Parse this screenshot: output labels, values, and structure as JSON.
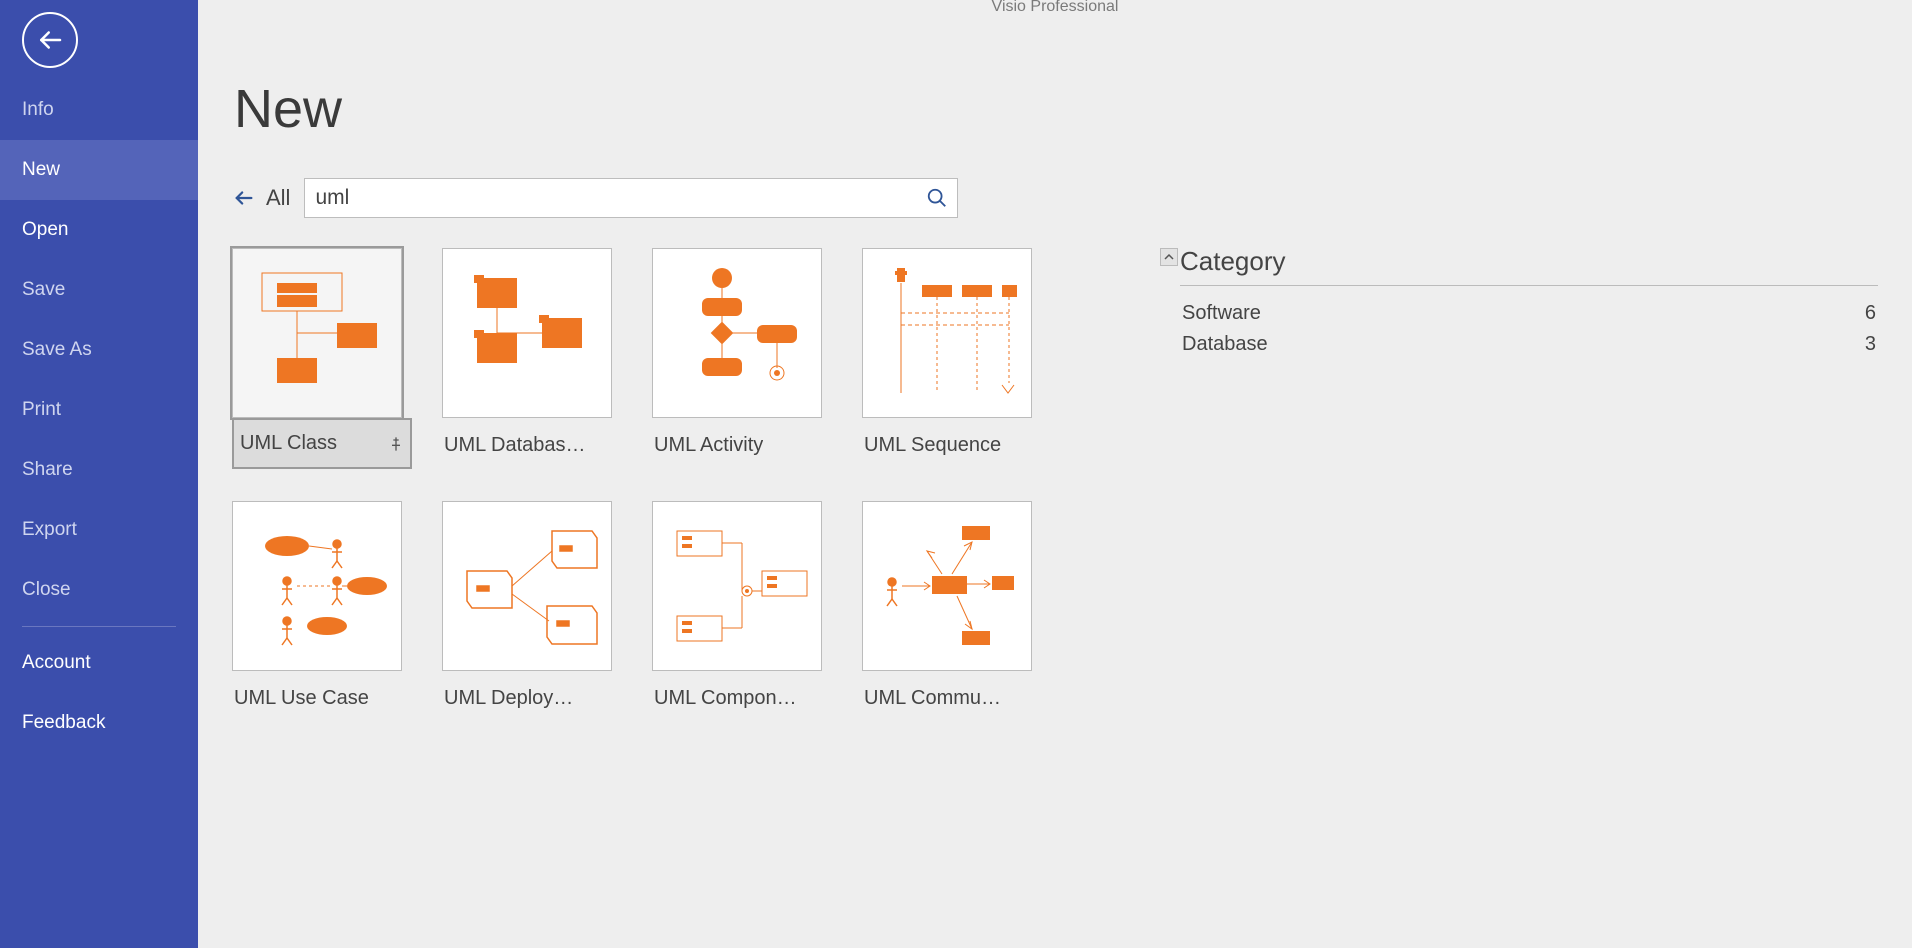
{
  "app_title": "Visio Professional",
  "sidebar": {
    "items": [
      {
        "label": "Info",
        "enabled": false,
        "selected": false
      },
      {
        "label": "New",
        "enabled": true,
        "selected": true
      },
      {
        "label": "Open",
        "enabled": true,
        "selected": false
      },
      {
        "label": "Save",
        "enabled": false,
        "selected": false
      },
      {
        "label": "Save As",
        "enabled": false,
        "selected": false
      },
      {
        "label": "Print",
        "enabled": false,
        "selected": false
      },
      {
        "label": "Share",
        "enabled": false,
        "selected": false
      },
      {
        "label": "Export",
        "enabled": false,
        "selected": false
      },
      {
        "label": "Close",
        "enabled": false,
        "selected": false
      }
    ],
    "bottom": [
      {
        "label": "Account"
      },
      {
        "label": "Feedback"
      }
    ]
  },
  "page": {
    "title": "New",
    "all_label": "All",
    "search_value": "uml"
  },
  "templates": [
    {
      "label": "UML Class",
      "selected": true,
      "pin": true,
      "icon": "uml-class"
    },
    {
      "label": "UML Databas…",
      "selected": false,
      "pin": false,
      "icon": "uml-database"
    },
    {
      "label": "UML Activity",
      "selected": false,
      "pin": false,
      "icon": "uml-activity"
    },
    {
      "label": "UML Sequence",
      "selected": false,
      "pin": false,
      "icon": "uml-sequence"
    },
    {
      "label": "UML Use Case",
      "selected": false,
      "pin": false,
      "icon": "uml-usecase"
    },
    {
      "label": "UML Deploy…",
      "selected": false,
      "pin": false,
      "icon": "uml-deploy"
    },
    {
      "label": "UML Compon…",
      "selected": false,
      "pin": false,
      "icon": "uml-component"
    },
    {
      "label": "UML Commu…",
      "selected": false,
      "pin": false,
      "icon": "uml-commu"
    }
  ],
  "category": {
    "title": "Category",
    "items": [
      {
        "name": "Software",
        "count": 6
      },
      {
        "name": "Database",
        "count": 3
      }
    ]
  }
}
